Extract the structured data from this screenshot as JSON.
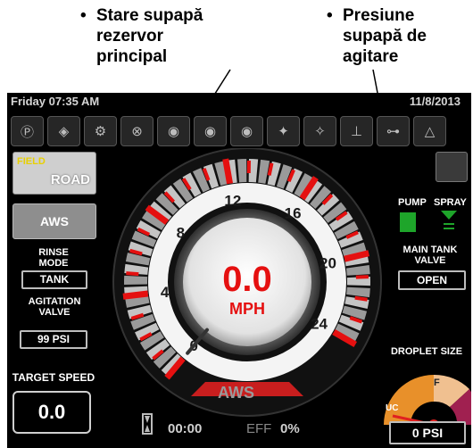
{
  "callouts": {
    "left": {
      "bullet": "•",
      "lines": [
        "Stare supapă",
        "rezervor",
        "principal"
      ]
    },
    "right": {
      "bullet": "•",
      "lines": [
        "Presiune",
        "supapă de",
        "agitare"
      ]
    }
  },
  "header": {
    "day_time": "Friday 07:35 AM",
    "date": "11/8/2013"
  },
  "icon_row": [
    {
      "name": "p-icon",
      "glyph": "Ⓟ"
    },
    {
      "name": "direction-icon",
      "glyph": "◈"
    },
    {
      "name": "boom-icon",
      "glyph": "⚙"
    },
    {
      "name": "engine-icon",
      "glyph": "⊗"
    },
    {
      "name": "tractor-icon",
      "glyph": "◉"
    },
    {
      "name": "tractor2-icon",
      "glyph": "◉"
    },
    {
      "name": "tractor3-icon",
      "glyph": "◉"
    },
    {
      "name": "fan-icon",
      "glyph": "✦"
    },
    {
      "name": "fan2-icon",
      "glyph": "✧"
    },
    {
      "name": "lift-icon",
      "glyph": "⊥"
    },
    {
      "name": "hitch-icon",
      "glyph": "⊶"
    },
    {
      "name": "hazard-icon",
      "glyph": "△"
    }
  ],
  "left_panel": {
    "field": "FIELD",
    "road": "ROAD",
    "aws": "AWS",
    "rinse_mode_label": [
      "RINSE",
      "MODE"
    ],
    "rinse_mode_value": "TANK",
    "agitation_label": [
      "AGITATION",
      "VALVE"
    ],
    "agitation_value": "99 PSI",
    "target_speed_label": "TARGET SPEED",
    "target_speed_value": "0.0"
  },
  "right_panel": {
    "pump": "PUMP",
    "spray": "SPRAY",
    "main_tank_label": [
      "MAIN TANK",
      "VALVE"
    ],
    "main_tank_value": "OPEN",
    "droplet_label": "DROPLET SIZE",
    "droplet_marks": [
      "F",
      "UC"
    ],
    "pressure_value": "0 PSI"
  },
  "speedometer": {
    "speed": "0.0",
    "unit": "MPH",
    "ticks": [
      "0",
      "4",
      "8",
      "12",
      "16",
      "20",
      "24"
    ],
    "min": 0,
    "max": 24,
    "needle_value": 0
  },
  "footer": {
    "mode": "AWS",
    "time": "00:00",
    "eff_label": "EFF",
    "eff_value": "0%"
  }
}
